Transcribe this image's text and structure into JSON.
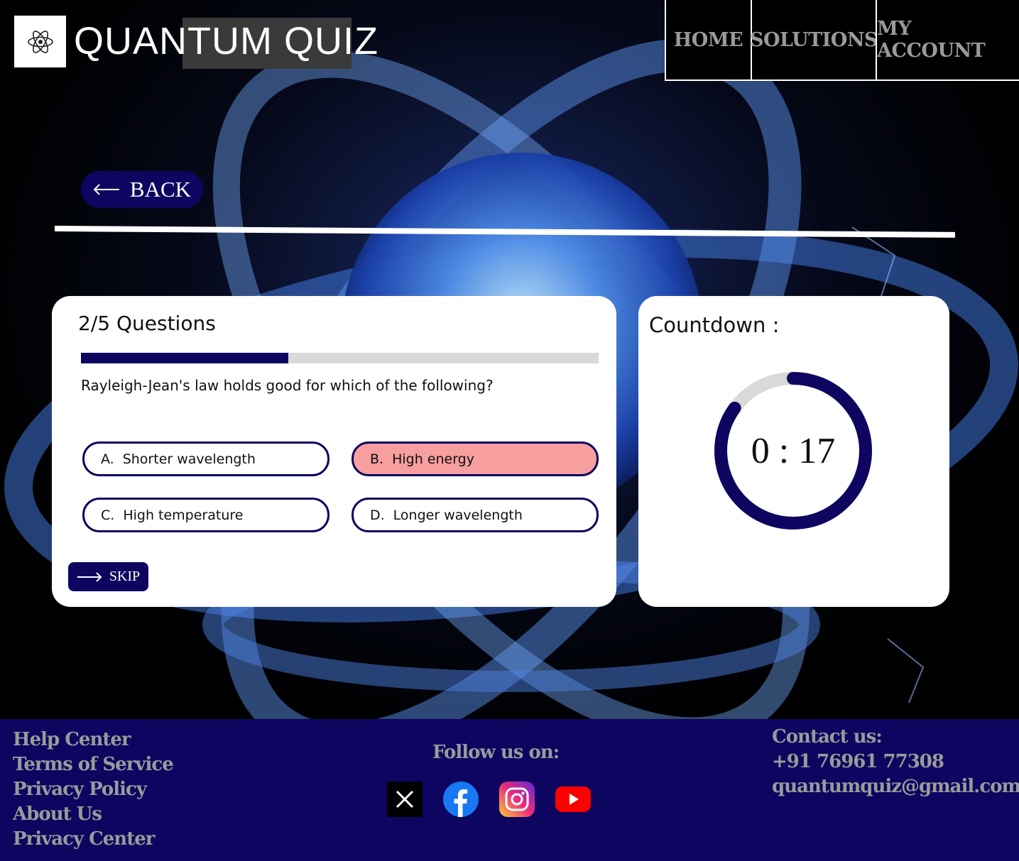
{
  "header": {
    "brand": "QUANTUM QUIZ",
    "nav": [
      "HOME",
      "SOLUTIONS",
      "MY ACCOUNT"
    ]
  },
  "back_button": {
    "label": "BACK"
  },
  "quiz": {
    "count_label": "2/5 Questions",
    "progress": 0.4,
    "question": "Rayleigh-Jean's law holds good for which of the following?",
    "options": [
      {
        "letter": "A.",
        "text": "Shorter wavelength"
      },
      {
        "letter": "B.",
        "text": "High energy"
      },
      {
        "letter": "C.",
        "text": "High temperature"
      },
      {
        "letter": "D.",
        "text": "Longer wavelength"
      }
    ],
    "selected": "B",
    "skip_label": "SKIP"
  },
  "countdown": {
    "title": "Countdown :",
    "time": "0 : 17",
    "remaining_fraction": 0.85
  },
  "footer": {
    "links": [
      "Help Center",
      "Terms of Service",
      "Privacy Policy",
      "About Us",
      "Privacy Center"
    ],
    "follow_label": "Follow us on:",
    "socials": [
      "x-icon",
      "facebook-icon",
      "instagram-icon",
      "youtube-icon"
    ],
    "contact_label": "Contact us:",
    "phone": "+91 76961 77308",
    "email": "quantumquiz@gmail.com"
  },
  "colors": {
    "primary": "#0d0560",
    "selected_option": "#f79e9e",
    "track": "#d9d9d9",
    "footer_text": "#9a9a9a"
  }
}
